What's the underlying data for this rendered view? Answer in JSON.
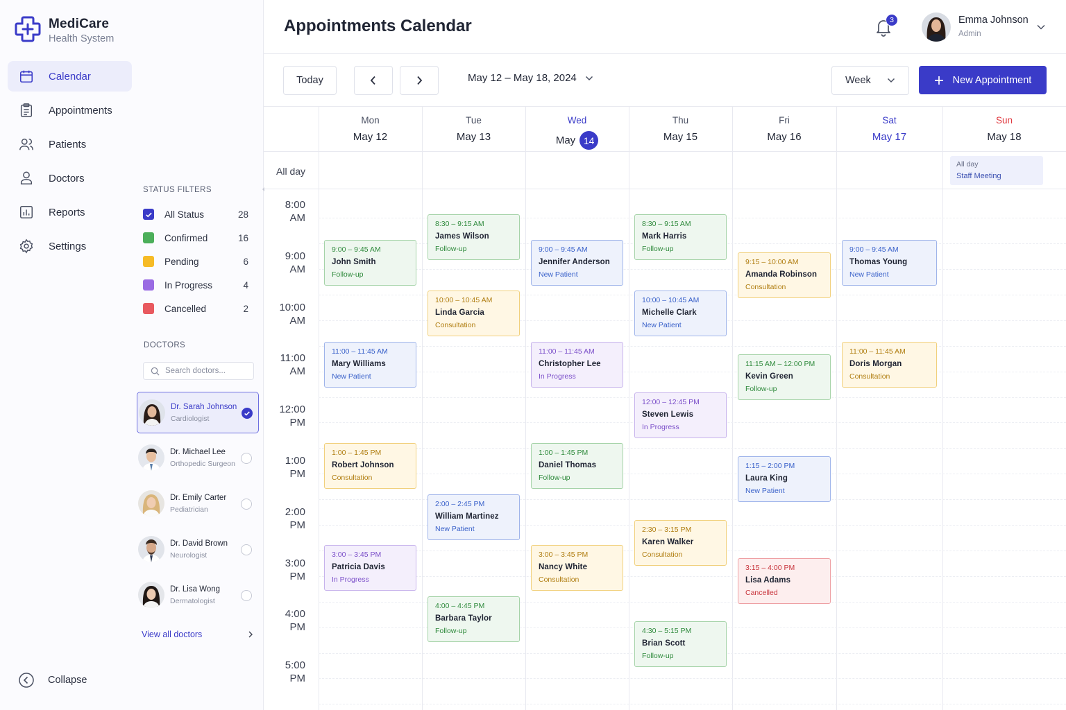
{
  "brand": {
    "name": "MediCare",
    "subtitle": "Health System"
  },
  "nav": [
    {
      "label": "Calendar",
      "icon": "calendar-icon",
      "active": true
    },
    {
      "label": "Appointments",
      "icon": "clipboard-icon"
    },
    {
      "label": "Patients",
      "icon": "users-icon"
    },
    {
      "label": "Doctors",
      "icon": "user-icon"
    },
    {
      "label": "Reports",
      "icon": "bar-chart-icon"
    },
    {
      "label": "Settings",
      "icon": "gear-icon"
    }
  ],
  "status_filters": {
    "title": "STATUS FILTERS",
    "items": [
      {
        "label": "All Status",
        "count": "28",
        "color": "#3a3bc8",
        "checked": true
      },
      {
        "label": "Confirmed",
        "count": "16",
        "color": "#4caf5a"
      },
      {
        "label": "Pending",
        "count": "6",
        "color": "#f6bb26"
      },
      {
        "label": "In Progress",
        "count": "4",
        "color": "#9a6be3"
      },
      {
        "label": "Cancelled",
        "count": "2",
        "color": "#e8595f"
      }
    ]
  },
  "doctors": {
    "title": "DOCTORS",
    "search_placeholder": "Search doctors...",
    "items": [
      {
        "name": "Dr. Sarah Johnson",
        "specialty": "Cardiologist",
        "selected": true
      },
      {
        "name": "Dr. Michael Lee",
        "specialty": "Orthopedic Surgeon"
      },
      {
        "name": "Dr. Emily Carter",
        "specialty": "Pediatrician"
      },
      {
        "name": "Dr. David Brown",
        "specialty": "Neurologist"
      },
      {
        "name": "Dr. Lisa Wong",
        "specialty": "Dermatologist"
      }
    ],
    "view_all": "View all doctors"
  },
  "collapse_label": "Collapse",
  "header": {
    "title": "Appointments Calendar",
    "notifications": "3",
    "user_name": "Emma Johnson",
    "user_role": "Admin"
  },
  "toolbar": {
    "today": "Today",
    "range": "May 12 – May 18, 2024",
    "view": "Week",
    "new_label": "New Appointment"
  },
  "days": [
    {
      "name": "Mon",
      "date": "May 12"
    },
    {
      "name": "Tue",
      "date": "May 13"
    },
    {
      "name": "Wed",
      "date": "May",
      "day": "14",
      "today": true
    },
    {
      "name": "Thu",
      "date": "May 15"
    },
    {
      "name": "Fri",
      "date": "May 16"
    },
    {
      "name": "Sat",
      "date": "May 17",
      "color": "#3a3bc8"
    },
    {
      "name": "Sun",
      "date": "May 18",
      "color": "#e0383e"
    }
  ],
  "allday_label": "All day",
  "allday_event": {
    "label": "All day",
    "title": "Staff Meeting"
  },
  "times": [
    {
      "h": "8:00",
      "p": "AM"
    },
    {
      "h": "9:00",
      "p": "AM"
    },
    {
      "h": "10:00",
      "p": "AM"
    },
    {
      "h": "11:00",
      "p": "AM"
    },
    {
      "h": "12:00",
      "p": "PM"
    },
    {
      "h": "1:00",
      "p": "PM"
    },
    {
      "h": "2:00",
      "p": "PM"
    },
    {
      "h": "3:00",
      "p": "PM"
    },
    {
      "h": "4:00",
      "p": "PM"
    },
    {
      "h": "5:00",
      "p": "PM"
    }
  ],
  "events": [
    {
      "day": 0,
      "time": "9:00 – 9:45 AM",
      "name": "John Smith",
      "status": "Follow-up",
      "color": "green"
    },
    {
      "day": 0,
      "time": "11:00 – 11:45 AM",
      "name": "Mary Williams",
      "status": "New Patient",
      "color": "blue"
    },
    {
      "day": 0,
      "time": "1:00 – 1:45 PM",
      "name": "Robert Johnson",
      "status": "Consultation",
      "color": "yellow"
    },
    {
      "day": 0,
      "time": "3:00 – 3:45 PM",
      "name": "Patricia Davis",
      "status": "In Progress",
      "color": "purple"
    },
    {
      "day": 1,
      "time": "8:30 – 9:15 AM",
      "name": "James Wilson",
      "status": "Follow-up",
      "color": "green"
    },
    {
      "day": 1,
      "time": "10:00 – 10:45 AM",
      "name": "Linda Garcia",
      "status": "Consultation",
      "color": "yellow"
    },
    {
      "day": 1,
      "time": "2:00 – 2:45 PM",
      "name": "William Martinez",
      "status": "New Patient",
      "color": "blue"
    },
    {
      "day": 1,
      "time": "4:00 – 4:45 PM",
      "name": "Barbara Taylor",
      "status": "Follow-up",
      "color": "green"
    },
    {
      "day": 2,
      "time": "9:00 – 9:45 AM",
      "name": "Jennifer Anderson",
      "status": "New Patient",
      "color": "blue"
    },
    {
      "day": 2,
      "time": "11:00 – 11:45 AM",
      "name": "Christopher Lee",
      "status": "In Progress",
      "color": "purple"
    },
    {
      "day": 2,
      "time": "1:00 – 1:45 PM",
      "name": "Daniel Thomas",
      "status": "Follow-up",
      "color": "green"
    },
    {
      "day": 2,
      "time": "3:00 – 3:45 PM",
      "name": "Nancy White",
      "status": "Consultation",
      "color": "yellow"
    },
    {
      "day": 3,
      "time": "8:30 – 9:15 AM",
      "name": "Mark Harris",
      "status": "Follow-up",
      "color": "green"
    },
    {
      "day": 3,
      "time": "10:00 – 10:45 AM",
      "name": "Michelle Clark",
      "status": "New Patient",
      "color": "blue"
    },
    {
      "day": 3,
      "time": "12:00 – 12:45 PM",
      "name": "Steven Lewis",
      "status": "In Progress",
      "color": "purple"
    },
    {
      "day": 3,
      "time": "2:30 – 3:15 PM",
      "name": "Karen Walker",
      "status": "Consultation",
      "color": "yellow"
    },
    {
      "day": 3,
      "time": "4:30 – 5:15 PM",
      "name": "Brian Scott",
      "status": "Follow-up",
      "color": "green"
    },
    {
      "day": 4,
      "time": "9:15 – 10:00 AM",
      "name": "Amanda Robinson",
      "status": "Consultation",
      "color": "yellow"
    },
    {
      "day": 4,
      "time": "11:15 AM – 12:00 PM",
      "name": "Kevin Green",
      "status": "Follow-up",
      "color": "green"
    },
    {
      "day": 4,
      "time": "1:15 – 2:00 PM",
      "name": "Laura King",
      "status": "New Patient",
      "color": "blue"
    },
    {
      "day": 4,
      "time": "3:15 – 4:00 PM",
      "name": "Lisa Adams",
      "status": "Cancelled",
      "color": "red"
    },
    {
      "day": 5,
      "time": "9:00 – 9:45 AM",
      "name": "Thomas Young",
      "status": "New Patient",
      "color": "blue"
    },
    {
      "day": 5,
      "time": "11:00 – 11:45 AM",
      "name": "Doris Morgan",
      "status": "Consultation",
      "color": "yellow"
    }
  ]
}
